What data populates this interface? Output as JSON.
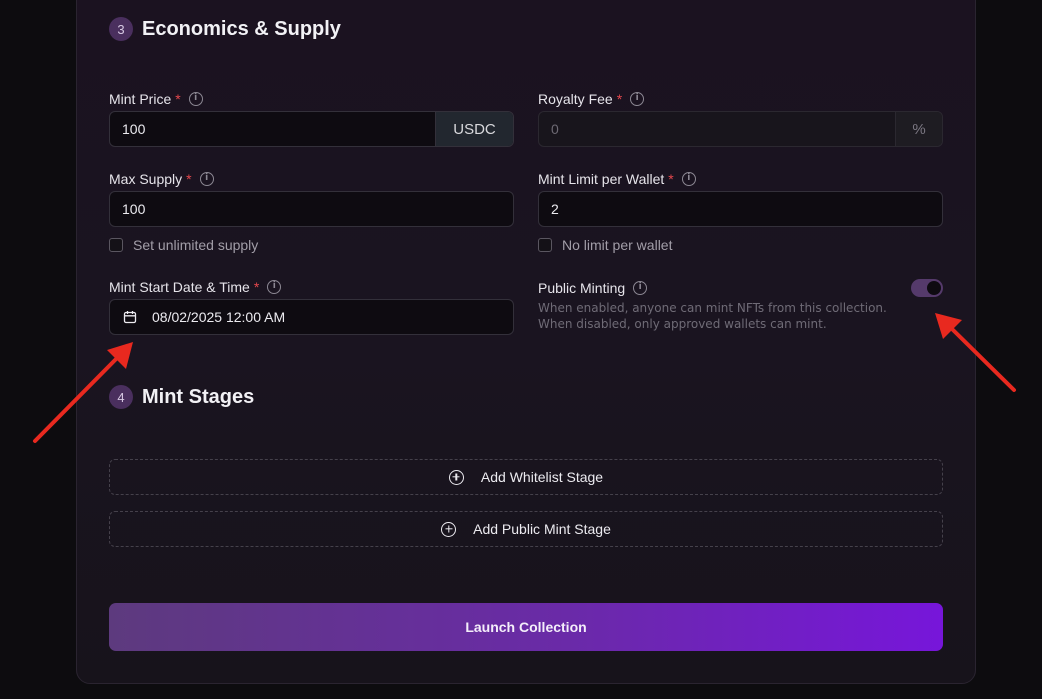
{
  "section3": {
    "number": "3",
    "title": "Economics & Supply"
  },
  "mint_price": {
    "label": "Mint Price",
    "required": "*",
    "value": "100",
    "currency": "USDC"
  },
  "royalty_fee": {
    "label": "Royalty Fee",
    "required": "*",
    "placeholder": "0",
    "unit": "%"
  },
  "max_supply": {
    "label": "Max Supply",
    "required": "*",
    "value": "100",
    "checkbox_label": "Set unlimited supply"
  },
  "mint_limit": {
    "label": "Mint Limit per Wallet",
    "required": "*",
    "value": "2",
    "checkbox_label": "No limit per wallet"
  },
  "mint_start": {
    "label": "Mint Start Date & Time",
    "required": "*",
    "value": "08/02/2025 12:00 AM"
  },
  "public_minting": {
    "label": "Public Minting",
    "enabled": true,
    "help": "When enabled, anyone can mint NFTs from this collection. When disabled, only approved wallets can mint."
  },
  "section4": {
    "number": "4",
    "title": "Mint Stages"
  },
  "stages": {
    "add_whitelist": "Add Whitelist Stage",
    "add_public": "Add Public Mint Stage"
  },
  "launch": {
    "label": "Launch Collection"
  },
  "colors": {
    "accent": "#7716da",
    "required": "#e5484d",
    "annotation_arrow": "#e8291f"
  }
}
